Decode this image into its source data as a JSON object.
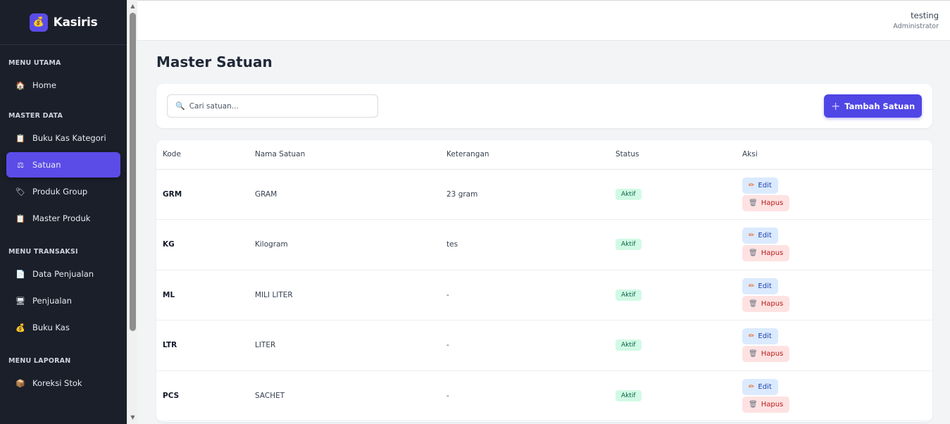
{
  "app": {
    "name": "Kasiris",
    "logo_icon": "💰"
  },
  "user": {
    "name": "testing",
    "role": "Administrator"
  },
  "sidebar": {
    "sections": [
      {
        "title": "MENU UTAMA",
        "items": [
          {
            "label": "Home",
            "icon": "🏠"
          }
        ]
      },
      {
        "title": "MASTER DATA",
        "items": [
          {
            "label": "Buku Kas Kategori",
            "icon": "📋"
          },
          {
            "label": "Satuan",
            "icon": "⚖"
          },
          {
            "label": "Produk Group",
            "icon": "🏷"
          },
          {
            "label": "Master Produk",
            "icon": "📋"
          }
        ]
      },
      {
        "title": "MENU TRANSAKSI",
        "items": [
          {
            "label": "Data Penjualan",
            "icon": "📄"
          },
          {
            "label": "Penjualan",
            "icon": "🖥"
          },
          {
            "label": "Buku Kas",
            "icon": "💰"
          }
        ]
      },
      {
        "title": "MENU LAPORAN",
        "items": [
          {
            "label": "Koreksi Stok",
            "icon": "📦"
          }
        ]
      }
    ],
    "active": "Satuan"
  },
  "page": {
    "title": "Master Satuan"
  },
  "search": {
    "placeholder": "Cari satuan..."
  },
  "toolbar": {
    "add_label": "Tambah Satuan"
  },
  "table": {
    "headers": [
      "Kode",
      "Nama Satuan",
      "Keterangan",
      "Status",
      "Aksi"
    ],
    "rows": [
      {
        "kode": "GRM",
        "nama": "GRAM",
        "keterangan": "23 gram",
        "status": "Aktif"
      },
      {
        "kode": "KG",
        "nama": "Kilogram",
        "keterangan": "tes",
        "status": "Aktif"
      },
      {
        "kode": "ML",
        "nama": "MILI LITER",
        "keterangan": "-",
        "status": "Aktif"
      },
      {
        "kode": "LTR",
        "nama": "LITER",
        "keterangan": "-",
        "status": "Aktif"
      },
      {
        "kode": "PCS",
        "nama": "SACHET",
        "keterangan": "-",
        "status": "Aktif"
      }
    ],
    "edit_label": "Edit",
    "hapus_label": "Hapus"
  },
  "colors": {
    "accent": "#4f46e5",
    "sidebar_bg": "#1b1f2a",
    "status_bg": "#d1fae5",
    "edit_bg": "#dbeafe",
    "hapus_bg": "#fee2e2"
  }
}
